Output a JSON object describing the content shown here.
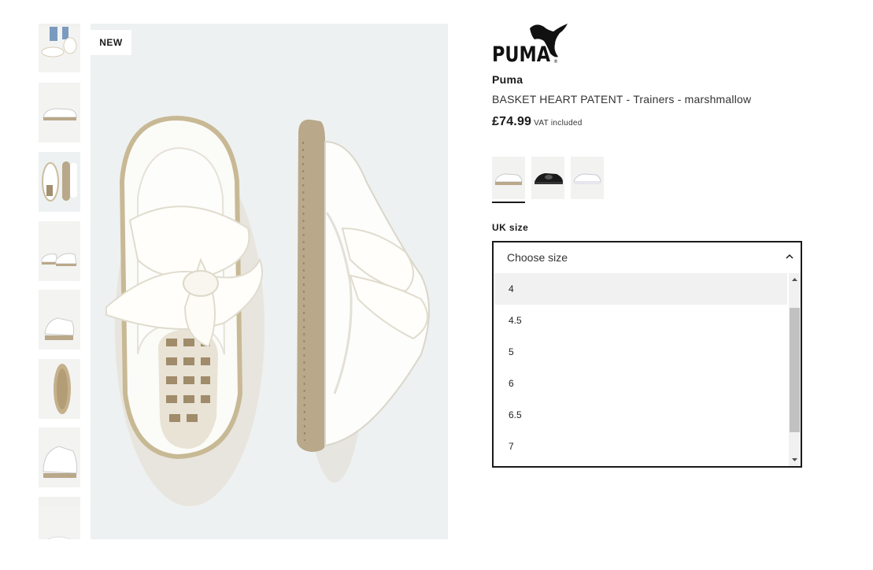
{
  "gallery": {
    "badge": "NEW",
    "thumbnail_count": 8,
    "active_thumbnail_index": 2
  },
  "product": {
    "logo_alt": "PUMA",
    "brand": "Puma",
    "name": "BASKET HEART PATENT - Trainers - marshmallow",
    "price": "£74.99",
    "vat_note": "VAT included"
  },
  "colours": [
    {
      "name": "marshmallow",
      "icon": "white-trainer-swatch",
      "selected": true
    },
    {
      "name": "black",
      "icon": "black-trainer-swatch",
      "selected": false
    },
    {
      "name": "white",
      "icon": "white-grey-trainer-swatch",
      "selected": false
    }
  ],
  "size": {
    "label": "UK size",
    "placeholder": "Choose size",
    "options": [
      "4",
      "4.5",
      "5",
      "6",
      "6.5",
      "7"
    ],
    "hovered_option": "4"
  },
  "colors": {
    "text": "#1a1a1a",
    "gum_sole": "#b9a88a",
    "image_bg": "#eef1f1",
    "scroll_thumb": "#c1c1c1"
  }
}
